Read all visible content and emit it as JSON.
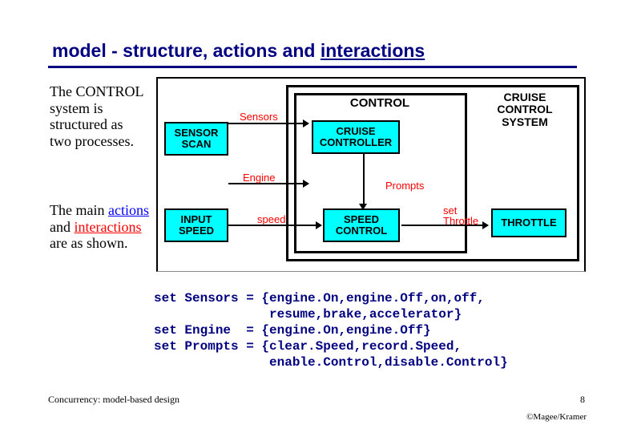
{
  "title": {
    "plain": "model  - structure, actions and ",
    "underlined": "interactions"
  },
  "para1": "The CONTROL system is structured as two processes.",
  "para2_parts": {
    "a": "The main ",
    "actions": "actions",
    "b": " and ",
    "interactions": "interactions",
    "c": " are as shown."
  },
  "diagram": {
    "outer_control": "CONTROL",
    "sensor_scan": "SENSOR\nSCAN",
    "input_speed": "INPUT\nSPEED",
    "cruise_controller": "CRUISE\nCONTROLLER",
    "speed_control": "SPEED\nCONTROL",
    "throttle": "THROTTLE",
    "cruise_system": "CRUISE\nCONTROL\nSYSTEM",
    "labels": {
      "sensors": "Sensors",
      "engine": "Engine",
      "speed": "speed",
      "prompts": "Prompts",
      "set_throttle": "set\nThrottle"
    }
  },
  "code": "set Sensors = {engine.On,engine.Off,on,off,\n               resume,brake,accelerator}\nset Engine  = {engine.On,engine.Off}\nset Prompts = {clear.Speed,record.Speed,\n               enable.Control,disable.Control}",
  "footer": {
    "left": "Concurrency: model-based design",
    "page": "8",
    "right": "©Magee/Kramer"
  }
}
